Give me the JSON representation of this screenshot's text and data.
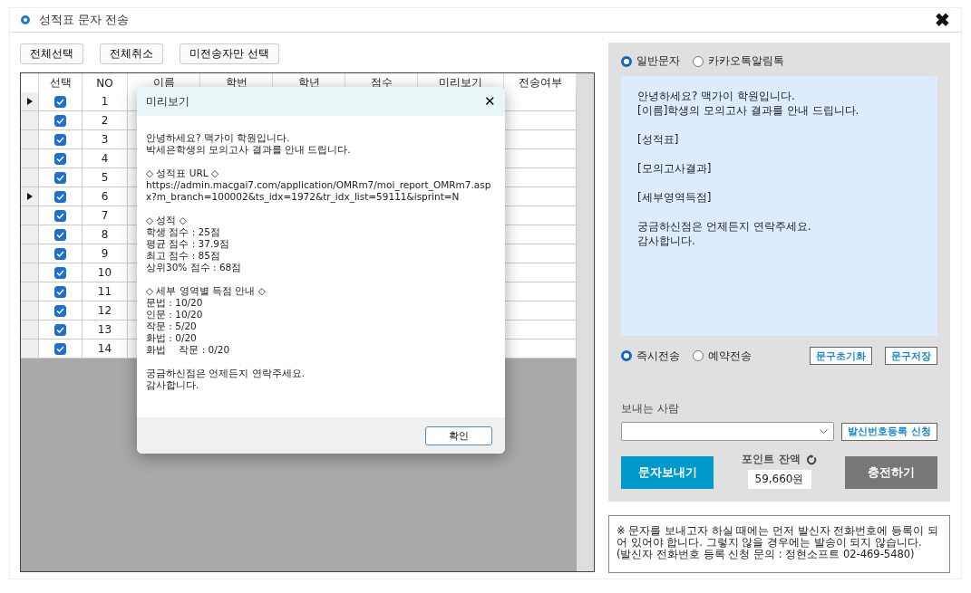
{
  "window": {
    "title": "성적표 문자 전송",
    "close": "✖"
  },
  "toolbar": [
    "전체선택",
    "전체취소",
    "미전송자만 선택"
  ],
  "table": {
    "columns": [
      "선택",
      "NO",
      "이름",
      "학번",
      "학년",
      "점수",
      "미리보기",
      "전송여부"
    ],
    "rows": [
      {
        "marker": true,
        "checked": true,
        "no": "1"
      },
      {
        "marker": false,
        "checked": true,
        "no": "2"
      },
      {
        "marker": false,
        "checked": true,
        "no": "3"
      },
      {
        "marker": false,
        "checked": true,
        "no": "4"
      },
      {
        "marker": false,
        "checked": true,
        "no": "5"
      },
      {
        "marker": true,
        "checked": true,
        "no": "6"
      },
      {
        "marker": false,
        "checked": true,
        "no": "7"
      },
      {
        "marker": false,
        "checked": true,
        "no": "8"
      },
      {
        "marker": false,
        "checked": true,
        "no": "9"
      },
      {
        "marker": false,
        "checked": true,
        "no": "10"
      },
      {
        "marker": false,
        "checked": true,
        "no": "11"
      },
      {
        "marker": false,
        "checked": true,
        "no": "12"
      },
      {
        "marker": false,
        "checked": true,
        "no": "13"
      },
      {
        "marker": false,
        "checked": true,
        "no": "14"
      }
    ]
  },
  "preview_dialog": {
    "title": "미리보기",
    "close": "✕",
    "paragraphs": [
      "안녕하세요? 맥가이 학원입니다.\n박세은학생의 모의고사 결과를 안내 드립니다.",
      "◇ 성적표 URL ◇\nhttps://admin.macgai7.com/application/OMRm7/moi_report_OMRm7.aspx?m_branch=100002&ts_idx=1972&tr_idx_list=59111&isprint=N",
      "◇ 성적 ◇\n학생 점수 : 25점\n평균 점수 : 37.9점\n최고 점수 : 85점\n상위30% 점수 : 68점",
      "◇ 세부 영역별 득점 안내 ◇\n문법 : 10/20\n인문 : 10/20\n작문 : 5/20\n화법 : 0/20\n화법　 작문 : 0/20",
      "궁금하신점은 언제든지 연락주세요.\n감사합니다."
    ],
    "ok": "확인"
  },
  "message_type": [
    {
      "label": "일반문자",
      "selected": true
    },
    {
      "label": "카카오톡알림톡",
      "selected": false
    }
  ],
  "message_text": "안녕하세요? 맥가이 학원입니다.\n[이름]학생의 모의고사 결과를 안내 드립니다.\n\n[성적표]\n\n[모의고사결과]\n\n[세부영역득점]\n\n궁금하신점은 언제든지 연락주세요.\n감사합니다.",
  "send_timing": [
    {
      "label": "즉시전송",
      "selected": true
    },
    {
      "label": "예약전송",
      "selected": false
    }
  ],
  "text_buttons": [
    "문구초기화",
    "문구저장"
  ],
  "sender": {
    "label": "보내는 사람",
    "register": "발신번호등록 신청"
  },
  "send_button": "문자보내기",
  "points": {
    "label": "포인트 잔액",
    "value": "59,660원"
  },
  "charge_button": "충전하기",
  "notice": "※ 문자를 보내고자 하실 때에는 먼저 발신자 전화번호에 등록이 되어 있어야 합니다. 그렇지 않을 경우에는 발송이 되지 않습니다.\n(발신자 전화번호 등록 신청 문의 : 정현소프트 02-469-5480)"
}
